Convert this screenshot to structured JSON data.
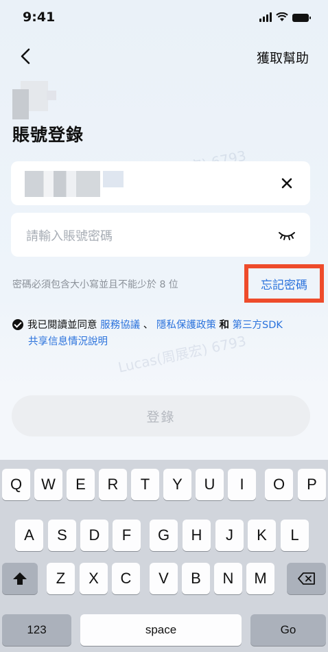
{
  "status_bar": {
    "time": "9:41"
  },
  "header": {
    "help": "獲取幫助"
  },
  "title": "賬號登錄",
  "password_field": {
    "placeholder": "請輸入賬號密碼"
  },
  "hint": "密碼必須包含大小寫並且不能少於 8 位",
  "forgot": "忘記密碼",
  "agreement": {
    "prefix": "我已閱讀並同意",
    "service": "服務協議",
    "sep": "、",
    "privacy": "隱私保護政策",
    "and": "和",
    "sdk_line1": "第三方SDK",
    "sdk_line2": "共享信息情況說明"
  },
  "login_button": "登錄",
  "watermark": "Lucas(周展宏) 6793",
  "keyboard": {
    "row1": [
      "Q",
      "W",
      "E",
      "R",
      "T",
      "Y",
      "U",
      "I",
      "O",
      "P"
    ],
    "row2": [
      "A",
      "S",
      "D",
      "F",
      "G",
      "H",
      "J",
      "K",
      "L"
    ],
    "row3": [
      "Z",
      "X",
      "C",
      "V",
      "B",
      "N",
      "M"
    ],
    "numbers": "123",
    "space": "space",
    "go": "Go"
  },
  "colors": {
    "accent": "#2a72dc",
    "highlight": "#ee4b2b"
  }
}
